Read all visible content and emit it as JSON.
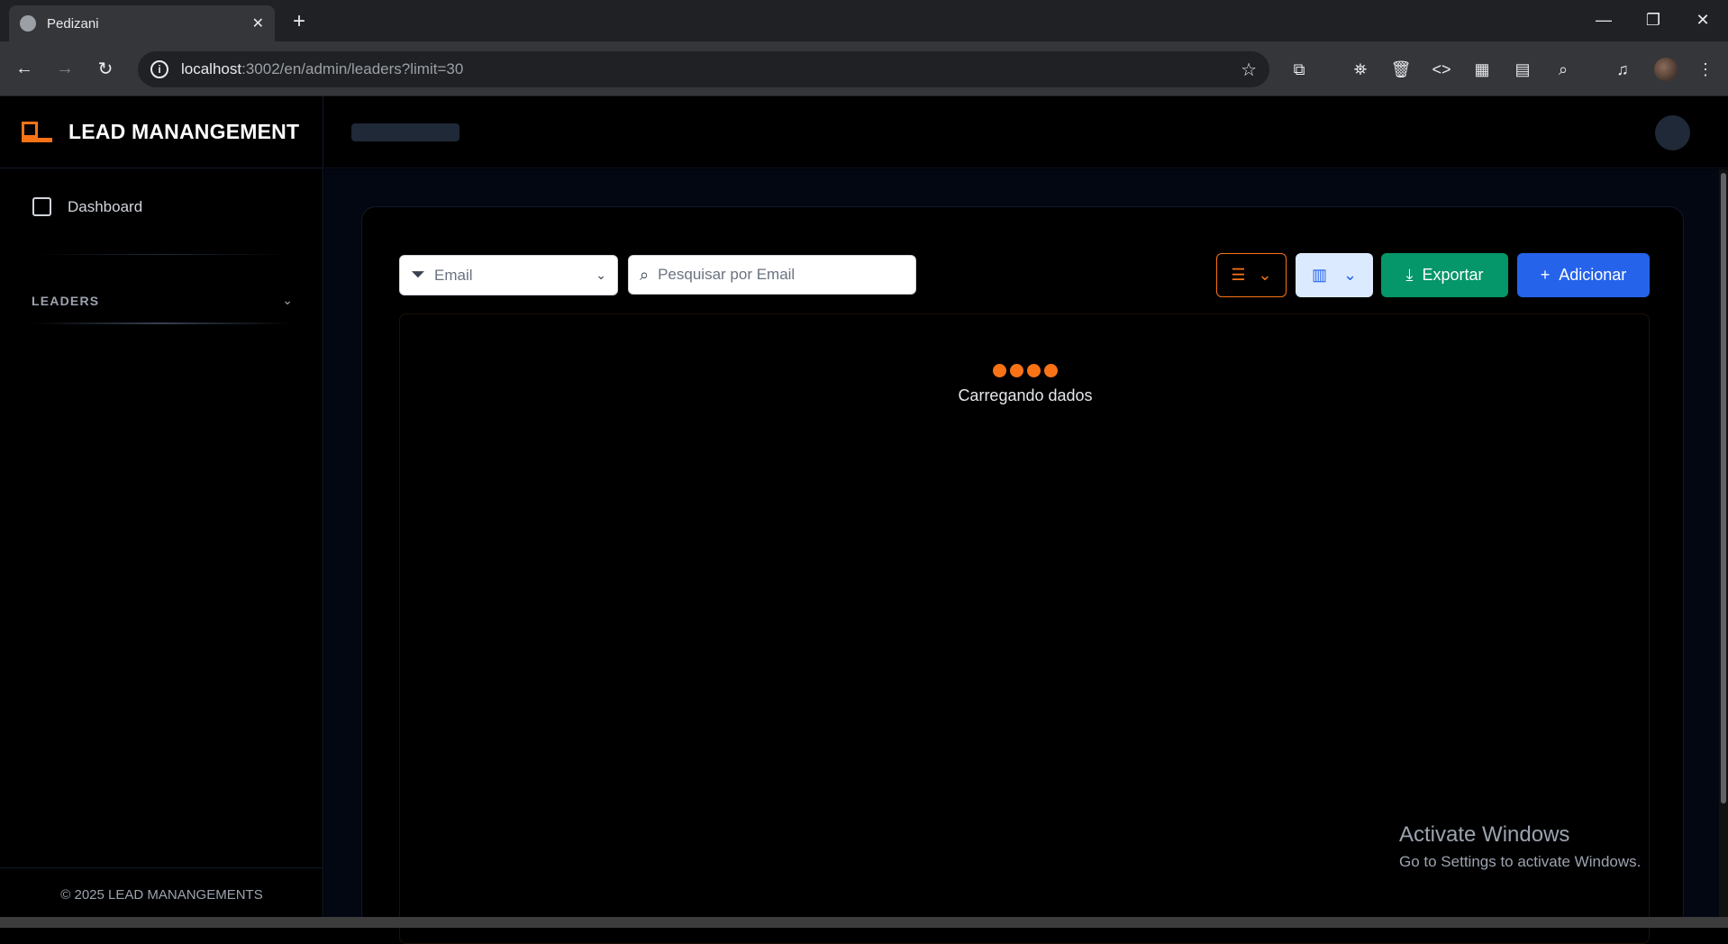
{
  "browser": {
    "tab_title": "Pedizani",
    "url_host": "localhost",
    "url_path": ":3002/en/admin/leaders?limit=30"
  },
  "sidebar": {
    "brand": "LEAD MANANGEMENT",
    "items": [
      {
        "label": "Dashboard"
      }
    ],
    "section_label": "LEADERS",
    "footer": "© 2025 LEAD MANANGEMENTS"
  },
  "toolbar": {
    "filter_value": "Email",
    "search_placeholder": "Pesquisar por Email",
    "export_label": "Exportar",
    "add_label": "Adicionar"
  },
  "table": {
    "loading_text": "Carregando dados"
  },
  "overlay": {
    "activate_title": "Activate Windows",
    "activate_subtitle": "Go to Settings to activate Windows."
  },
  "colors": {
    "accent": "#f97316",
    "export": "#059669",
    "add": "#2563eb"
  }
}
